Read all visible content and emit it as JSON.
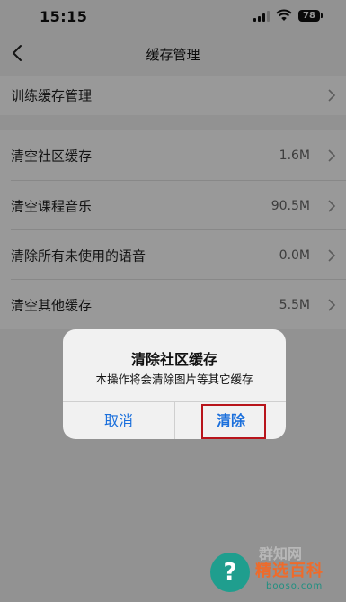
{
  "status_bar": {
    "time": "15:15",
    "battery": "78"
  },
  "nav": {
    "title": "缓存管理",
    "back_icon": "chevron-left-icon"
  },
  "rows": [
    {
      "label": "训练缓存管理",
      "value": ""
    },
    {
      "label": "清空社区缓存",
      "value": "1.6M"
    },
    {
      "label": "清空课程音乐",
      "value": "90.5M"
    },
    {
      "label": "清除所有未使用的语音",
      "value": "0.0M"
    },
    {
      "label": "清空其他缓存",
      "value": "5.5M"
    }
  ],
  "alert": {
    "title": "清除社区缓存",
    "message": "本操作将会清除图片等其它缓存",
    "cancel_label": "取消",
    "confirm_label": "清除",
    "button_color": "#1a6fdc",
    "highlight_color": "#b8141b"
  },
  "watermark": {
    "text": "精选百科",
    "site": "booso.com",
    "top_text": "群知网"
  }
}
